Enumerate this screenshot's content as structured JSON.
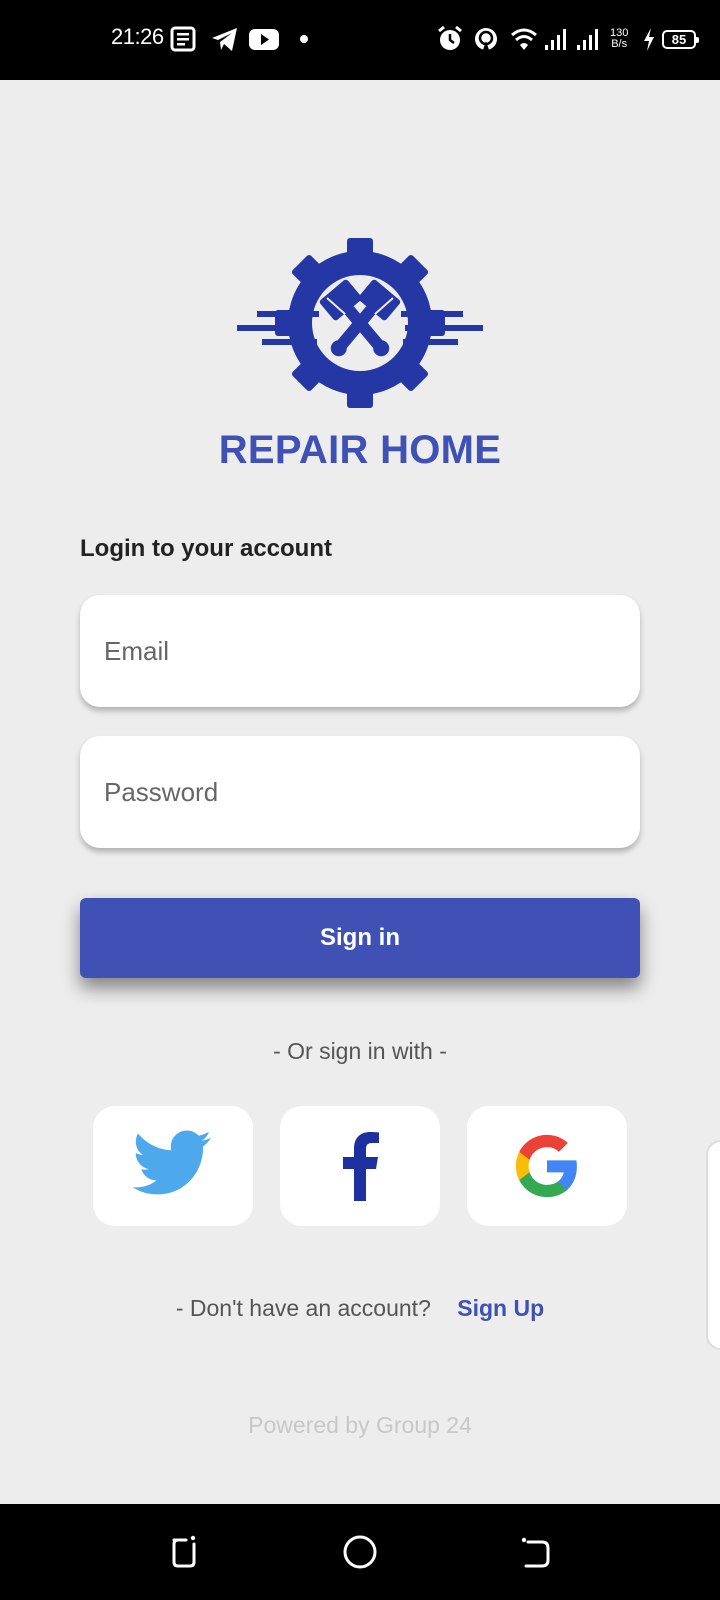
{
  "status_bar": {
    "time": "21:26",
    "net_speed_value": "130",
    "net_speed_unit": "B/s",
    "battery": "85",
    "icons": [
      "news-icon",
      "telegram-icon",
      "youtube-icon",
      "dot-icon",
      "alarm-icon",
      "hotspot-icon",
      "wifi-icon",
      "signal-icon",
      "signal-icon",
      "charging-icon"
    ]
  },
  "app": {
    "brand": "REPAIR HOME",
    "login_heading": "Login to your account",
    "email_placeholder": "Email",
    "password_placeholder": "Password",
    "signin_label": "Sign in",
    "or_text": "- Or sign in with -",
    "social": [
      "twitter-icon",
      "facebook-icon",
      "google-icon"
    ],
    "signup_prompt": "- Don't have an account?",
    "signup_link": "Sign Up",
    "powered_by": "Powered by Group 24"
  },
  "colors": {
    "accent": "#3f51b5",
    "logo": "#2537a5",
    "twitter": "#4ea9ec",
    "facebook": "#1e2fa0",
    "background": "#ededed"
  },
  "nav_bar": {
    "buttons": [
      "recents-icon",
      "home-icon",
      "back-icon"
    ]
  }
}
